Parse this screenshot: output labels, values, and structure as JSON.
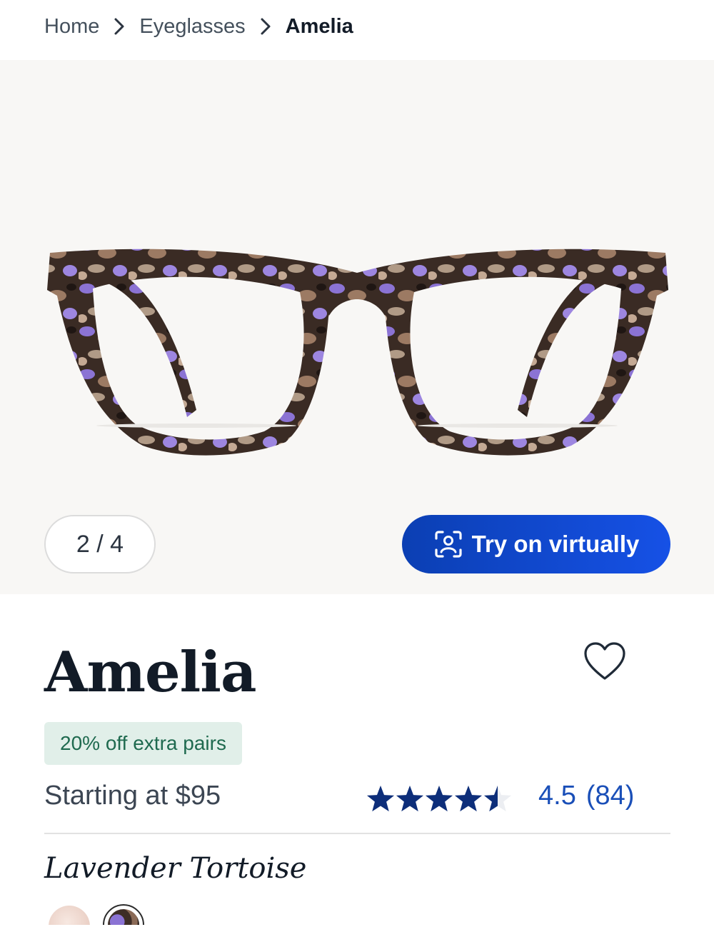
{
  "breadcrumb": {
    "home": "Home",
    "category": "Eyeglasses",
    "current": "Amelia"
  },
  "gallery": {
    "counter": "2 / 4",
    "try_on_label": "Try on virtually"
  },
  "product": {
    "name": "Amelia",
    "promo": "20% off extra pairs",
    "price_text": "Starting at $95",
    "rating_value": "4.5",
    "rating_count": "(84)",
    "rating_stars": 4.5,
    "color_name": "Lavender Tortoise"
  },
  "icons": {
    "breadcrumb_separator": "chevron-right-icon",
    "try_on": "face-scan-icon",
    "favorite": "heart-outline-icon",
    "rating": "star-icon"
  },
  "colors": {
    "accent": "#1651e6",
    "star": "#0d2e7a",
    "promo_bg": "#e1efe9",
    "promo_text": "#1f6a4f",
    "frame_lavender": "#8b73d4",
    "frame_tortoise_dark": "#2d211c"
  }
}
